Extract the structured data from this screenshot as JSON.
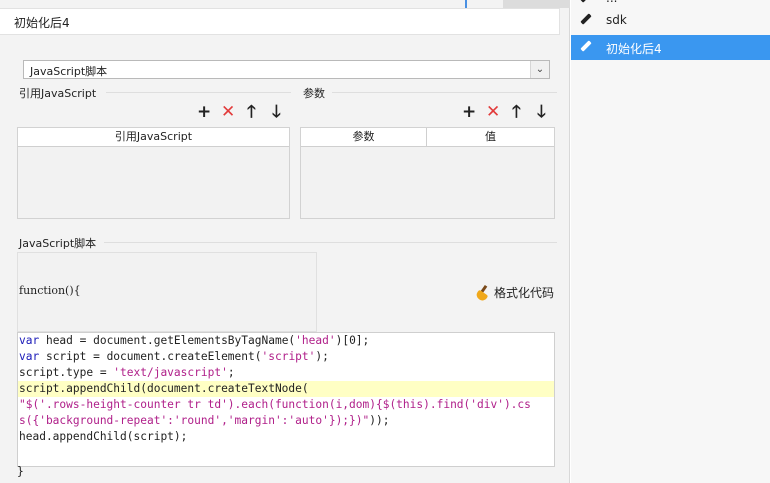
{
  "dialog": {
    "title": "初始化后4",
    "type_select": {
      "value": "JavaScript脚本"
    }
  },
  "ref_section": {
    "header": "引用JavaScript",
    "columns": [
      "引用JavaScript"
    ],
    "toolbar": {
      "add": "+",
      "delete": "✕",
      "up": "🡑",
      "down": "🡓"
    }
  },
  "param_section": {
    "header": "参数",
    "columns": [
      "参数",
      "值"
    ],
    "toolbar": {
      "add": "+",
      "delete": "✕",
      "up": "🡑",
      "down": "🡓"
    }
  },
  "script_section": {
    "header": "JavaScript脚本",
    "signature": "function(){",
    "format_label": "格式化代码",
    "closing": "}"
  },
  "code_lines": [
    [
      {
        "t": "var",
        "c": "kw"
      },
      {
        "t": " head = document.getElementsByTagName("
      },
      {
        "t": "'head'",
        "c": "str"
      },
      {
        "t": ")[0];"
      }
    ],
    [
      {
        "t": "var",
        "c": "kw"
      },
      {
        "t": " script = document.createElement("
      },
      {
        "t": "'script'",
        "c": "str"
      },
      {
        "t": ");"
      }
    ],
    [
      {
        "t": "script.type = "
      },
      {
        "t": "'text/javascript'",
        "c": "str"
      },
      {
        "t": ";"
      }
    ],
    [
      {
        "t": "script.appendChild(document.createTextNode("
      }
    ],
    [
      {
        "t": "\"$('.rows-height-counter tr td').each(function(i,dom){$(this).find('div').cs",
        "c": "str"
      }
    ],
    [
      {
        "t": "s({'background-repeat':'round','margin':'auto'});})\"",
        "c": "str"
      },
      {
        "t": "));"
      }
    ],
    [
      {
        "t": "head.appendChild(script);"
      }
    ]
  ],
  "right_panel": {
    "items": [
      {
        "label": "...",
        "selected": false
      },
      {
        "label": "sdk",
        "selected": false
      },
      {
        "label": "初始化后4",
        "selected": true
      }
    ]
  }
}
